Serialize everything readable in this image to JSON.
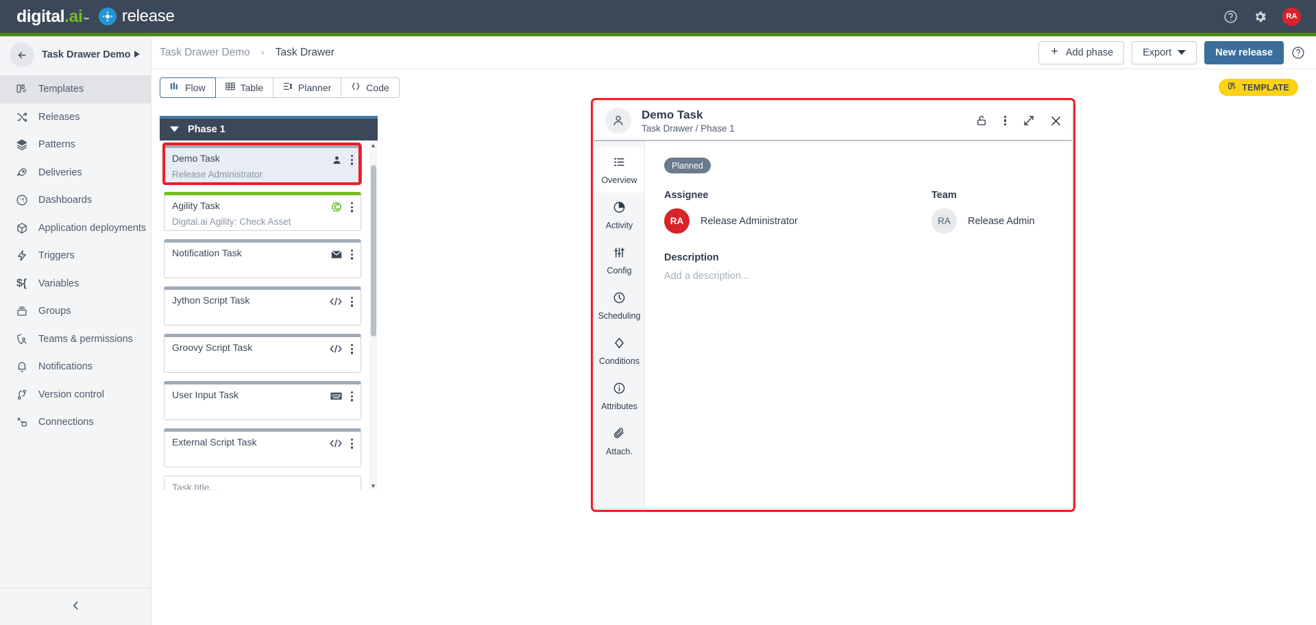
{
  "topbar": {
    "brand_primary": "digital.ai",
    "brand_secondary": "release",
    "help_icon": "help-circle-icon",
    "settings_icon": "gear-icon",
    "avatar_initials": "RA"
  },
  "sidebar": {
    "project_name": "Task Drawer Demo",
    "back_icon": "arrow-left-icon",
    "expand_icon": "play-triangle-icon",
    "collapse_icon": "chevron-left-icon",
    "items": [
      {
        "label": "Templates",
        "icon": "templates-icon",
        "active": true
      },
      {
        "label": "Releases",
        "icon": "shuffle-icon",
        "active": false
      },
      {
        "label": "Patterns",
        "icon": "layers-icon",
        "active": false
      },
      {
        "label": "Deliveries",
        "icon": "rocket-icon",
        "active": false
      },
      {
        "label": "Dashboards",
        "icon": "gauge-icon",
        "active": false
      },
      {
        "label": "Application deployments",
        "icon": "package-icon",
        "active": false
      },
      {
        "label": "Triggers",
        "icon": "lightning-icon",
        "active": false
      },
      {
        "label": "Variables",
        "icon": "dollar-brace-icon",
        "active": false
      },
      {
        "label": "Groups",
        "icon": "drawer-icon",
        "active": false
      },
      {
        "label": "Teams & permissions",
        "icon": "shield-person-icon",
        "active": false
      },
      {
        "label": "Notifications",
        "icon": "bell-icon",
        "active": false
      },
      {
        "label": "Version control",
        "icon": "git-branch-icon",
        "active": false
      },
      {
        "label": "Connections",
        "icon": "plug-icon",
        "active": false
      }
    ]
  },
  "breadcrumb": {
    "parent": "Task Drawer Demo",
    "separator": "›",
    "current": "Task Drawer"
  },
  "toolbar": {
    "add_phase_label": "Add phase",
    "add_phase_icon": "plus-icon",
    "export_label": "Export",
    "export_icon": "chevron-down-icon",
    "new_release_label": "New release",
    "help_icon": "help-circle-icon"
  },
  "tabs": [
    {
      "label": "Flow",
      "icon": "flow-bars-icon",
      "active": true
    },
    {
      "label": "Table",
      "icon": "table-grid-icon",
      "active": false
    },
    {
      "label": "Planner",
      "icon": "planner-icon",
      "active": false
    },
    {
      "label": "Code",
      "icon": "code-braces-icon",
      "active": false
    }
  ],
  "template_badge": {
    "label": "TEMPLATE",
    "icon": "templates-icon",
    "color": "#fcd116"
  },
  "phase": {
    "name": "Phase 1",
    "collapse_icon": "caret-down-icon",
    "header_accent": "#4a7ba8",
    "tasks": [
      {
        "title": "Demo Task",
        "subtitle": "Release Administrator",
        "icon": "person-icon",
        "accent": "#a2acb8",
        "selected": true
      },
      {
        "title": "Agility Task",
        "subtitle": "Digital.ai Agility: Check Asset",
        "icon": "agility-icon",
        "accent": "#76bc21",
        "selected": false
      },
      {
        "title": "Notification Task",
        "subtitle": "",
        "icon": "envelope-icon",
        "accent": "#a2acb8",
        "selected": false
      },
      {
        "title": "Jython Script Task",
        "subtitle": "",
        "icon": "code-icon",
        "accent": "#a2acb8",
        "selected": false
      },
      {
        "title": "Groovy Script Task",
        "subtitle": "",
        "icon": "code-icon",
        "accent": "#a2acb8",
        "selected": false
      },
      {
        "title": "User Input Task",
        "subtitle": "",
        "icon": "keyboard-icon",
        "accent": "#a2acb8",
        "selected": false
      },
      {
        "title": "External Script Task",
        "subtitle": "",
        "icon": "code-icon",
        "accent": "#a2acb8",
        "selected": false
      }
    ],
    "new_task_placeholder": "Task title..."
  },
  "drawer": {
    "avatar_icon": "person-icon",
    "title": "Demo Task",
    "subtitle": "Task Drawer / Phase 1",
    "header_icons": [
      {
        "name": "lock-open-icon"
      },
      {
        "name": "kebab-menu-icon"
      },
      {
        "name": "expand-icon"
      },
      {
        "name": "close-icon"
      }
    ],
    "tabs": [
      {
        "label": "Overview",
        "icon": "list-icon",
        "active": true
      },
      {
        "label": "Activity",
        "icon": "pie-clock-icon",
        "active": false
      },
      {
        "label": "Config",
        "icon": "sliders-icon",
        "active": false
      },
      {
        "label": "Scheduling",
        "icon": "clock-icon",
        "active": false
      },
      {
        "label": "Conditions",
        "icon": "diamond-icon",
        "active": false
      },
      {
        "label": "Attributes",
        "icon": "info-circle-icon",
        "active": false
      },
      {
        "label": "Attach.",
        "icon": "paperclip-icon",
        "active": false
      }
    ],
    "status": "Planned",
    "content_icons": [
      {
        "name": "flag-icon"
      },
      {
        "name": "eye-icon"
      }
    ],
    "assignee_label": "Assignee",
    "assignee_initials": "RA",
    "assignee_name": "Release Administrator",
    "team_label": "Team",
    "team_initials": "RA",
    "team_name": "Release Admin",
    "description_label": "Description",
    "description_placeholder": "Add a description..."
  },
  "colors": {
    "brand_dark": "#3b4859",
    "brand_green": "#4f8a0f",
    "accent_blue": "#3a6f9c",
    "highlight_red": "#ee1c25",
    "avatar_red": "#d8232a"
  }
}
